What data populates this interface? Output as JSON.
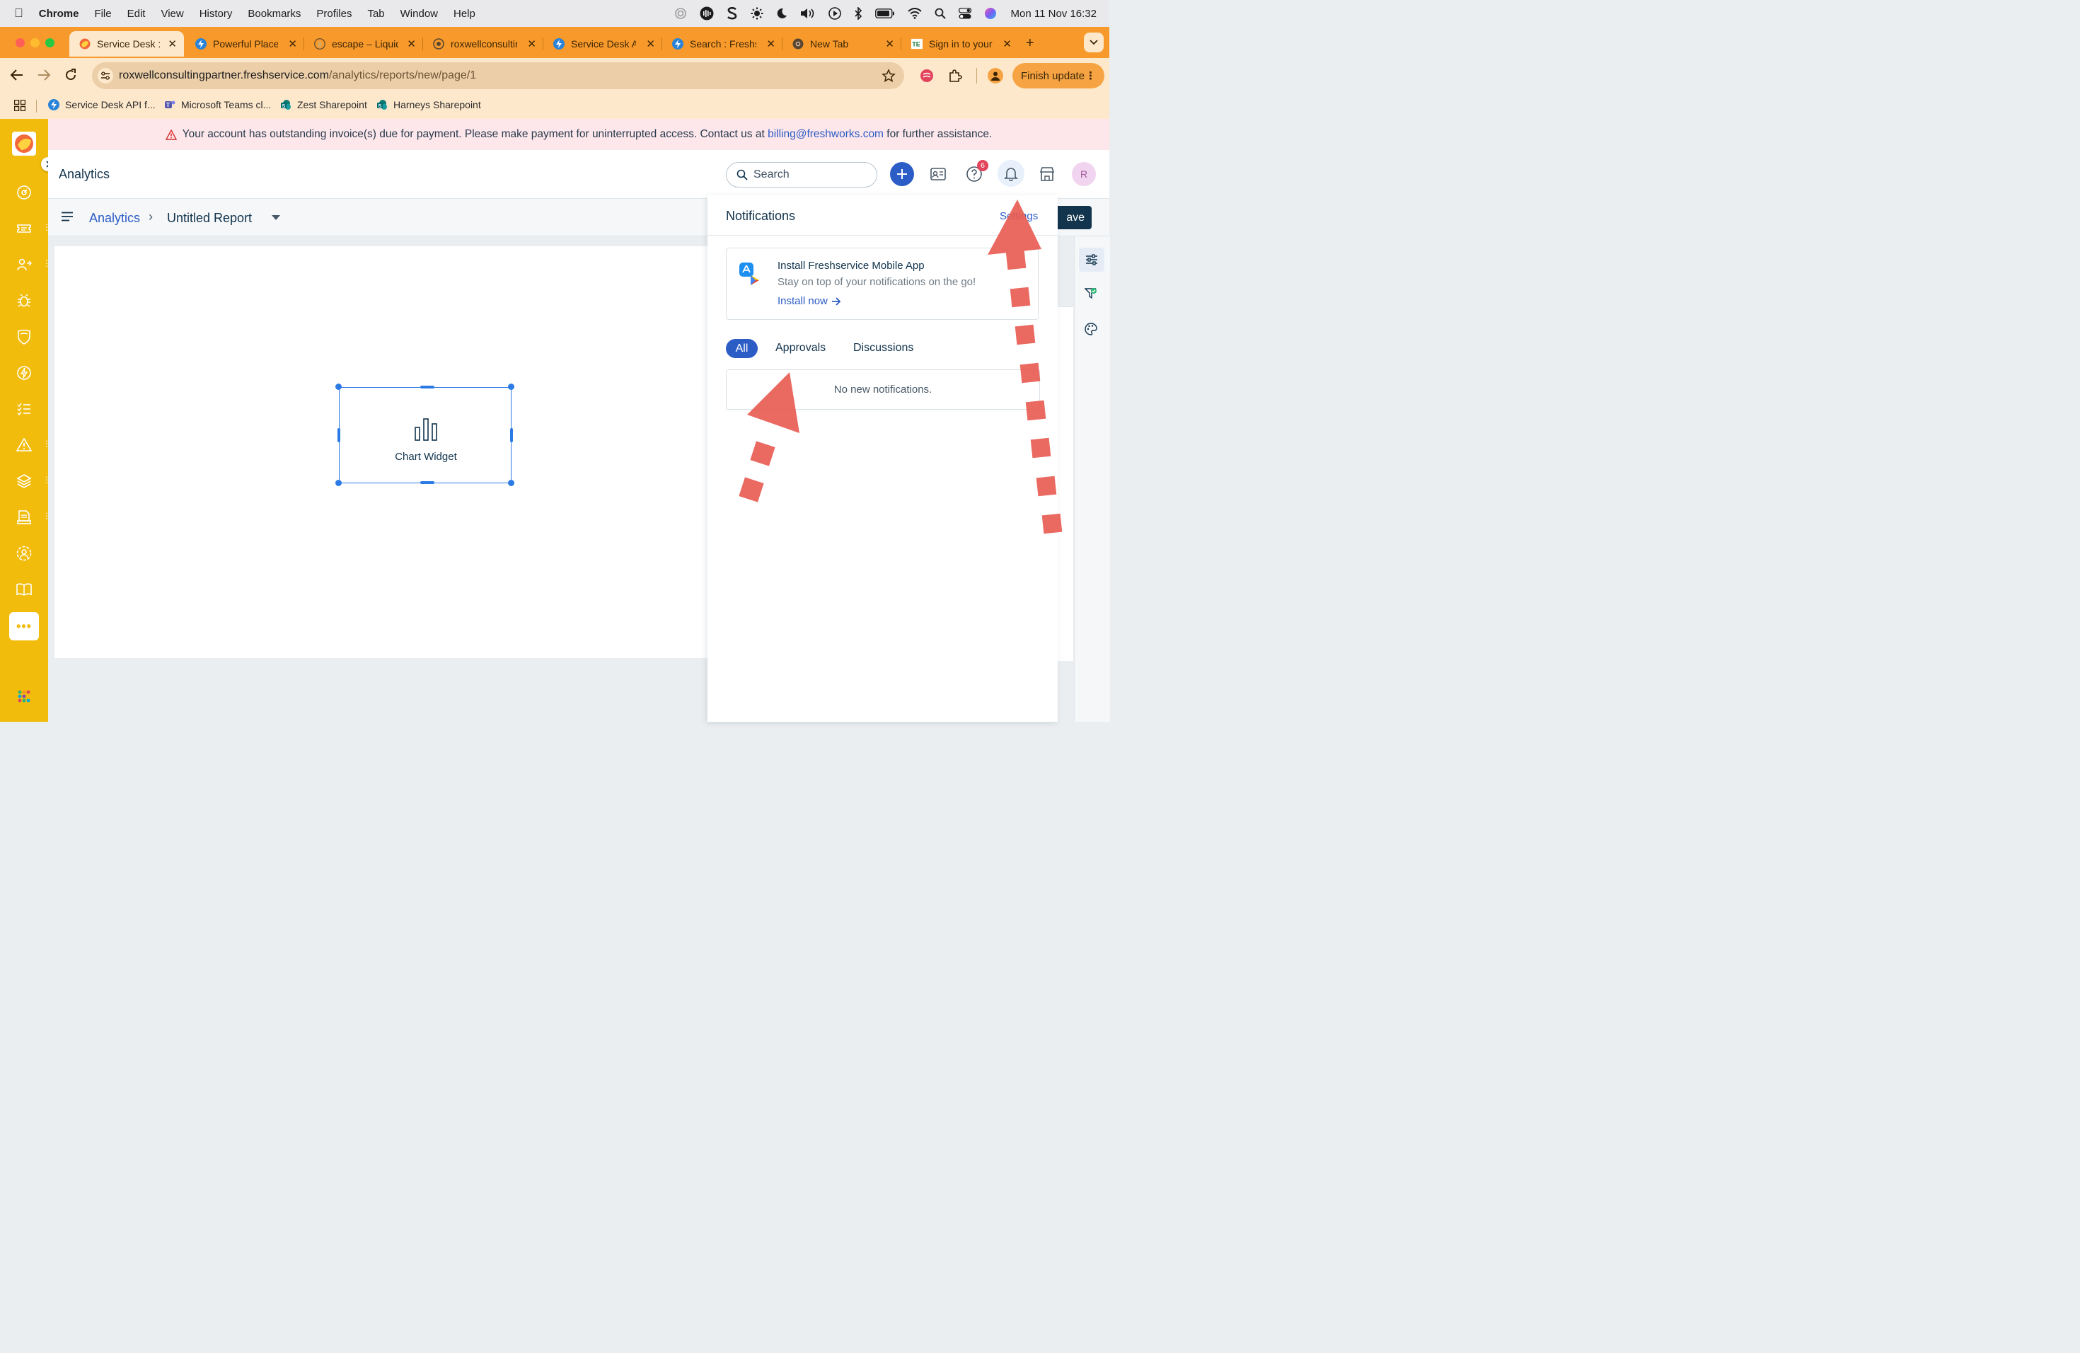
{
  "menubar": {
    "app": "Chrome",
    "items": [
      "File",
      "Edit",
      "View",
      "History",
      "Bookmarks",
      "Profiles",
      "Tab",
      "Window",
      "Help"
    ],
    "clock": "Mon 11 Nov  16:32"
  },
  "tabs": [
    {
      "label": "Service Desk : ",
      "active": true
    },
    {
      "label": "Powerful Placeh",
      "active": false
    },
    {
      "label": "escape – Liquid",
      "active": false
    },
    {
      "label": "roxwellconsultin",
      "active": false
    },
    {
      "label": "Service Desk A",
      "active": false
    },
    {
      "label": "Search : Freshs",
      "active": false
    },
    {
      "label": "New Tab",
      "active": false
    },
    {
      "label": "Sign in to your",
      "active": false
    }
  ],
  "toolbar": {
    "url_host": "roxwellconsultingpartner.freshservice.com",
    "url_path": "/analytics/reports/new/page/1",
    "finish_update": "Finish update"
  },
  "bookmarks": [
    {
      "label": "Service Desk API f..."
    },
    {
      "label": "Microsoft Teams cl..."
    },
    {
      "label": "Zest Sharepoint"
    },
    {
      "label": "Harneys Sharepoint"
    }
  ],
  "banner": {
    "text_before": "Your account has outstanding invoice(s) due for payment. Please make payment for uninterrupted access. Contact us at ",
    "email": "billing@freshworks.com",
    "text_after": " for further assistance."
  },
  "header": {
    "title": "Analytics",
    "search_label": "Search",
    "help_badge": "6",
    "avatar_initial": "R"
  },
  "breadcrumb": {
    "root": "Analytics",
    "separator": "›",
    "current": "Untitled Report",
    "save_fragment": "ave"
  },
  "widget": {
    "label": "Chart Widget"
  },
  "notifications": {
    "title": "Notifications",
    "settings": "Settings",
    "promo_title": "Install Freshservice Mobile App",
    "promo_subtitle": "Stay on top of your notifications on the go!",
    "promo_link": "Install now",
    "tabs": [
      {
        "label": "All",
        "active": true
      },
      {
        "label": "Approvals",
        "active": false
      },
      {
        "label": "Discussions",
        "active": false
      }
    ],
    "empty": "No new notifications."
  },
  "colors": {
    "tabstrip": "#f89a2b",
    "toolbar": "#fde8cc",
    "appnav": "#f2bc0c",
    "accent_blue": "#2c5cc5",
    "annotation_red": "#e8584f"
  }
}
